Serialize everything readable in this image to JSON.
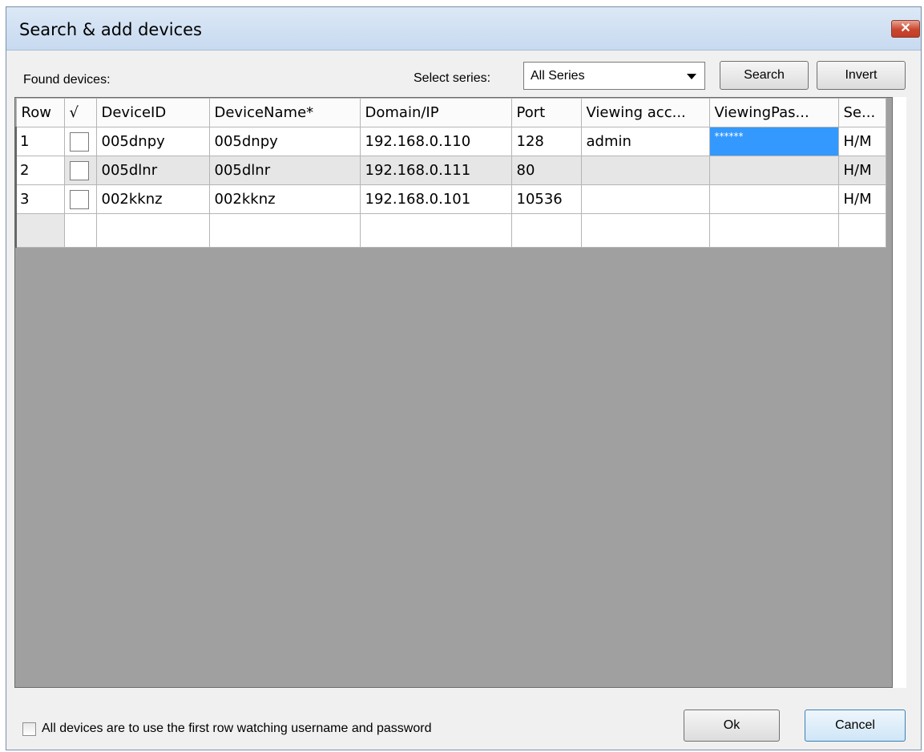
{
  "window": {
    "title": "Search & add devices",
    "close_glyph": "✕"
  },
  "toolbar": {
    "found_label": "Found devices:",
    "series_label": "Select series:",
    "series_value": "All Series",
    "search_label": "Search",
    "invert_label": "Invert"
  },
  "table": {
    "headers": [
      "Row",
      "√",
      "DeviceID",
      "DeviceName*",
      "Domain/IP",
      "Port",
      "Viewing acc...",
      "ViewingPas...",
      "Se..."
    ],
    "rows": [
      {
        "row": "1",
        "id": "005dnpy",
        "name": "005dnpy",
        "ip": "192.168.0.110",
        "port": "128",
        "account": "admin",
        "password": "******",
        "series": "H/M"
      },
      {
        "row": "2",
        "id": "005dlnr",
        "name": "005dlnr",
        "ip": "192.168.0.111",
        "port": "80",
        "account": "",
        "password": "",
        "series": "H/M"
      },
      {
        "row": "3",
        "id": "002kknz",
        "name": "002kknz",
        "ip": "192.168.0.101",
        "port": "10536",
        "account": "",
        "password": "",
        "series": "H/M"
      }
    ]
  },
  "footer": {
    "use_first_row_label": "All devices are to use the first row watching username and password",
    "ok_label": "Ok",
    "cancel_label": "Cancel"
  },
  "colors": {
    "selection": "#3399ff",
    "grid_background": "#a0a0a0",
    "close_button": "#c9462f"
  }
}
